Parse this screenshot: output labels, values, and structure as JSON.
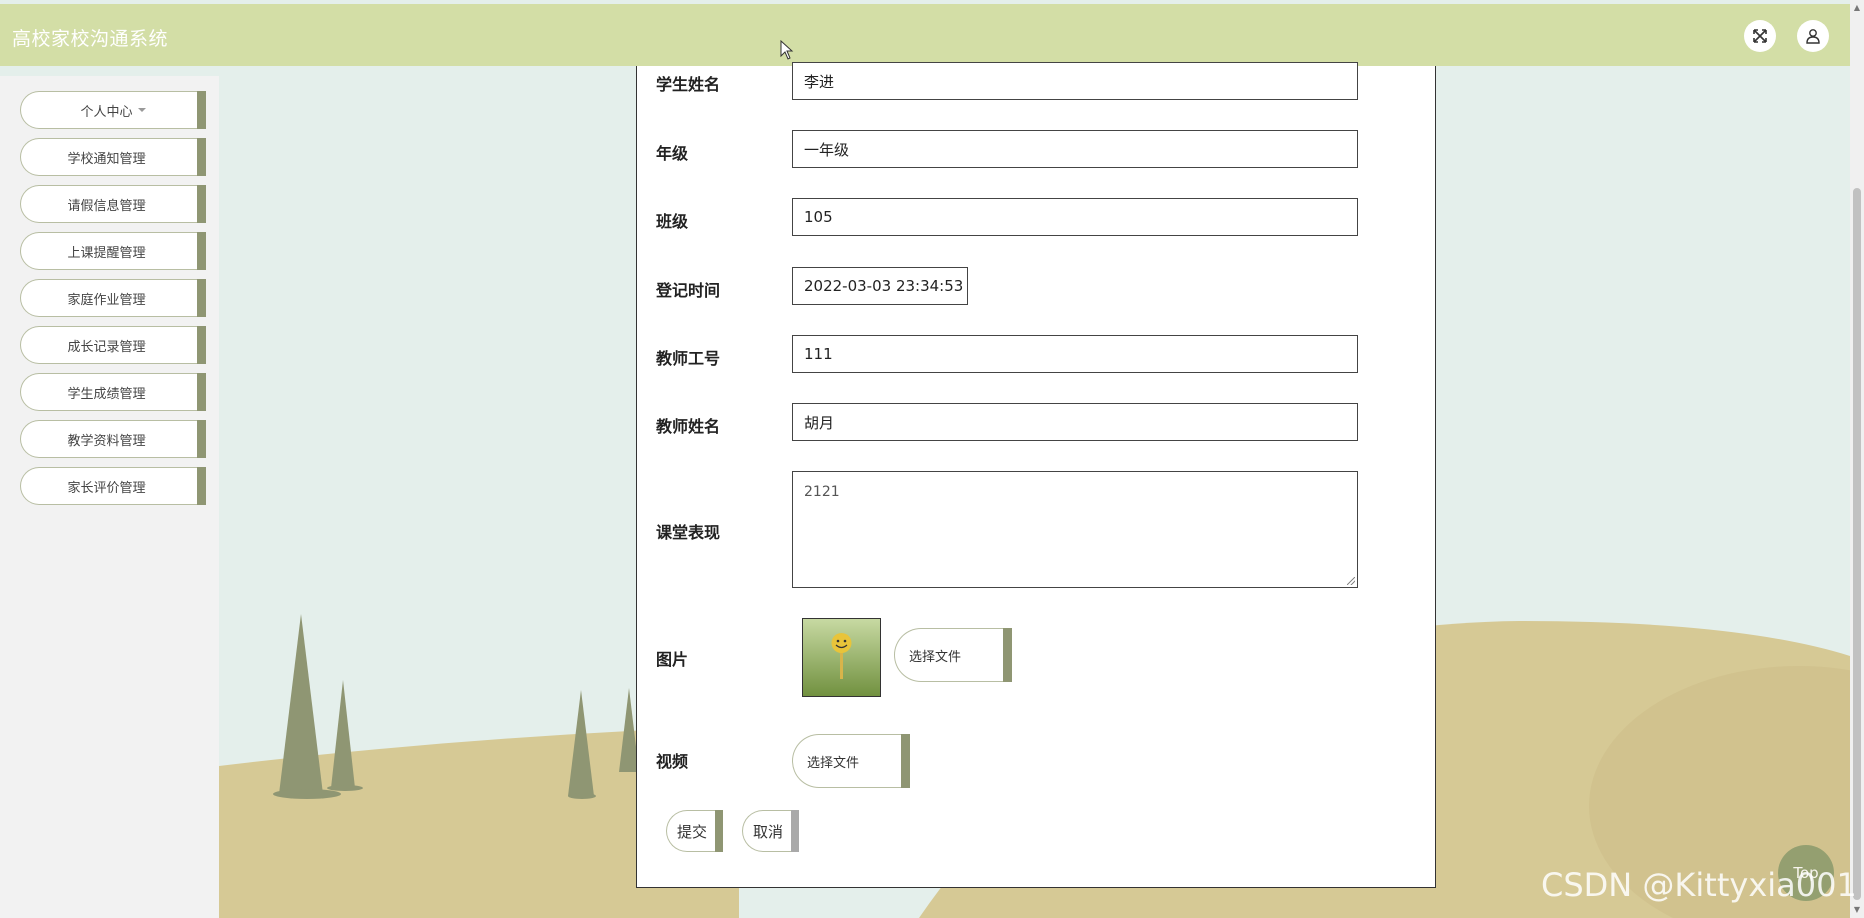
{
  "header": {
    "title": "高校家校沟通系统",
    "icons": [
      "fullscreen-icon",
      "user-icon"
    ]
  },
  "sidebar": {
    "items": [
      {
        "label": "个人中心"
      },
      {
        "label": "学校通知管理"
      },
      {
        "label": "请假信息管理"
      },
      {
        "label": "上课提醒管理"
      },
      {
        "label": "家庭作业管理"
      },
      {
        "label": "成长记录管理"
      },
      {
        "label": "学生成绩管理"
      },
      {
        "label": "教学资料管理"
      },
      {
        "label": "家长评价管理"
      }
    ]
  },
  "form": {
    "student_name": {
      "label": "学生姓名",
      "value": "李进"
    },
    "grade": {
      "label": "年级",
      "value": "一年级"
    },
    "class": {
      "label": "班级",
      "value": "105"
    },
    "register_time": {
      "label": "登记时间",
      "value": "2022-03-03 23:34:53"
    },
    "teacher_id": {
      "label": "教师工号",
      "value": "111"
    },
    "teacher_name": {
      "label": "教师姓名",
      "value": "胡月"
    },
    "performance": {
      "label": "课堂表现",
      "value": "2121"
    },
    "image": {
      "label": "图片",
      "button": "选择文件"
    },
    "video": {
      "label": "视频",
      "button": "选择文件"
    },
    "submit": "提交",
    "cancel": "取消"
  },
  "top_button": "Top",
  "watermark": "CSDN @Kittyxia001",
  "colors": {
    "header_bg": "#d3dea6",
    "accent": "#8f9673",
    "sidebar_bg": "#f2f2f2",
    "hill": "#d6c995",
    "tree": "#8f9673"
  }
}
